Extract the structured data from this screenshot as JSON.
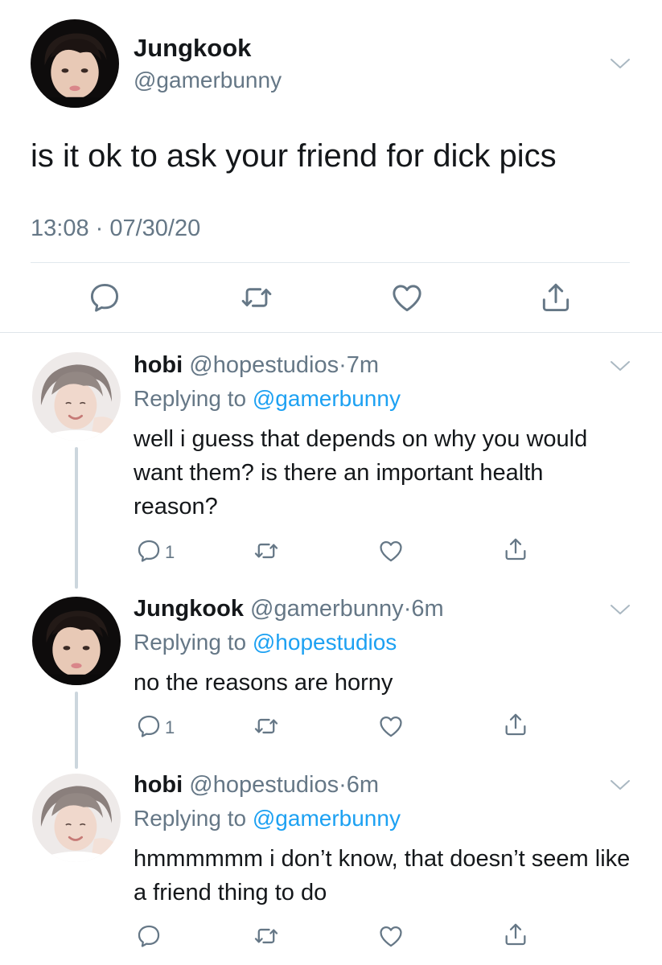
{
  "main_tweet": {
    "name": "Jungkook",
    "handle": "@gamerbunny",
    "text": "is it ok to ask your friend for dick pics",
    "timestamp": "13:08 · 07/30/20"
  },
  "replies": [
    {
      "name": "hobi",
      "handle": "@hopestudios",
      "sep": "·",
      "time": "7m",
      "replying_prefix": "Replying to ",
      "replying_to": "@gamerbunny",
      "text": "well i guess that depends on why you would want them? is there an important health reason?",
      "reply_count": "1"
    },
    {
      "name": "Jungkook",
      "handle": "@gamerbunny",
      "sep": "·",
      "time": "6m",
      "replying_prefix": "Replying to ",
      "replying_to": "@hopestudios",
      "text": "no the reasons are horny",
      "reply_count": "1"
    },
    {
      "name": "hobi",
      "handle": "@hopestudios",
      "sep": "·",
      "time": "6m",
      "replying_prefix": "Replying to ",
      "replying_to": "@gamerbunny",
      "text": "hmmmmmm i don’t know, that doesn’t seem like a friend thing to do",
      "reply_count": ""
    }
  ],
  "icons": [
    "reply-icon",
    "retweet-icon",
    "like-icon",
    "share-icon",
    "chevron-down-icon"
  ],
  "colors": {
    "text": "#14171a",
    "secondary": "#657786",
    "link": "#1da1f2",
    "divider": "#e1e8ed",
    "thread_line": "#ccd6dd"
  }
}
